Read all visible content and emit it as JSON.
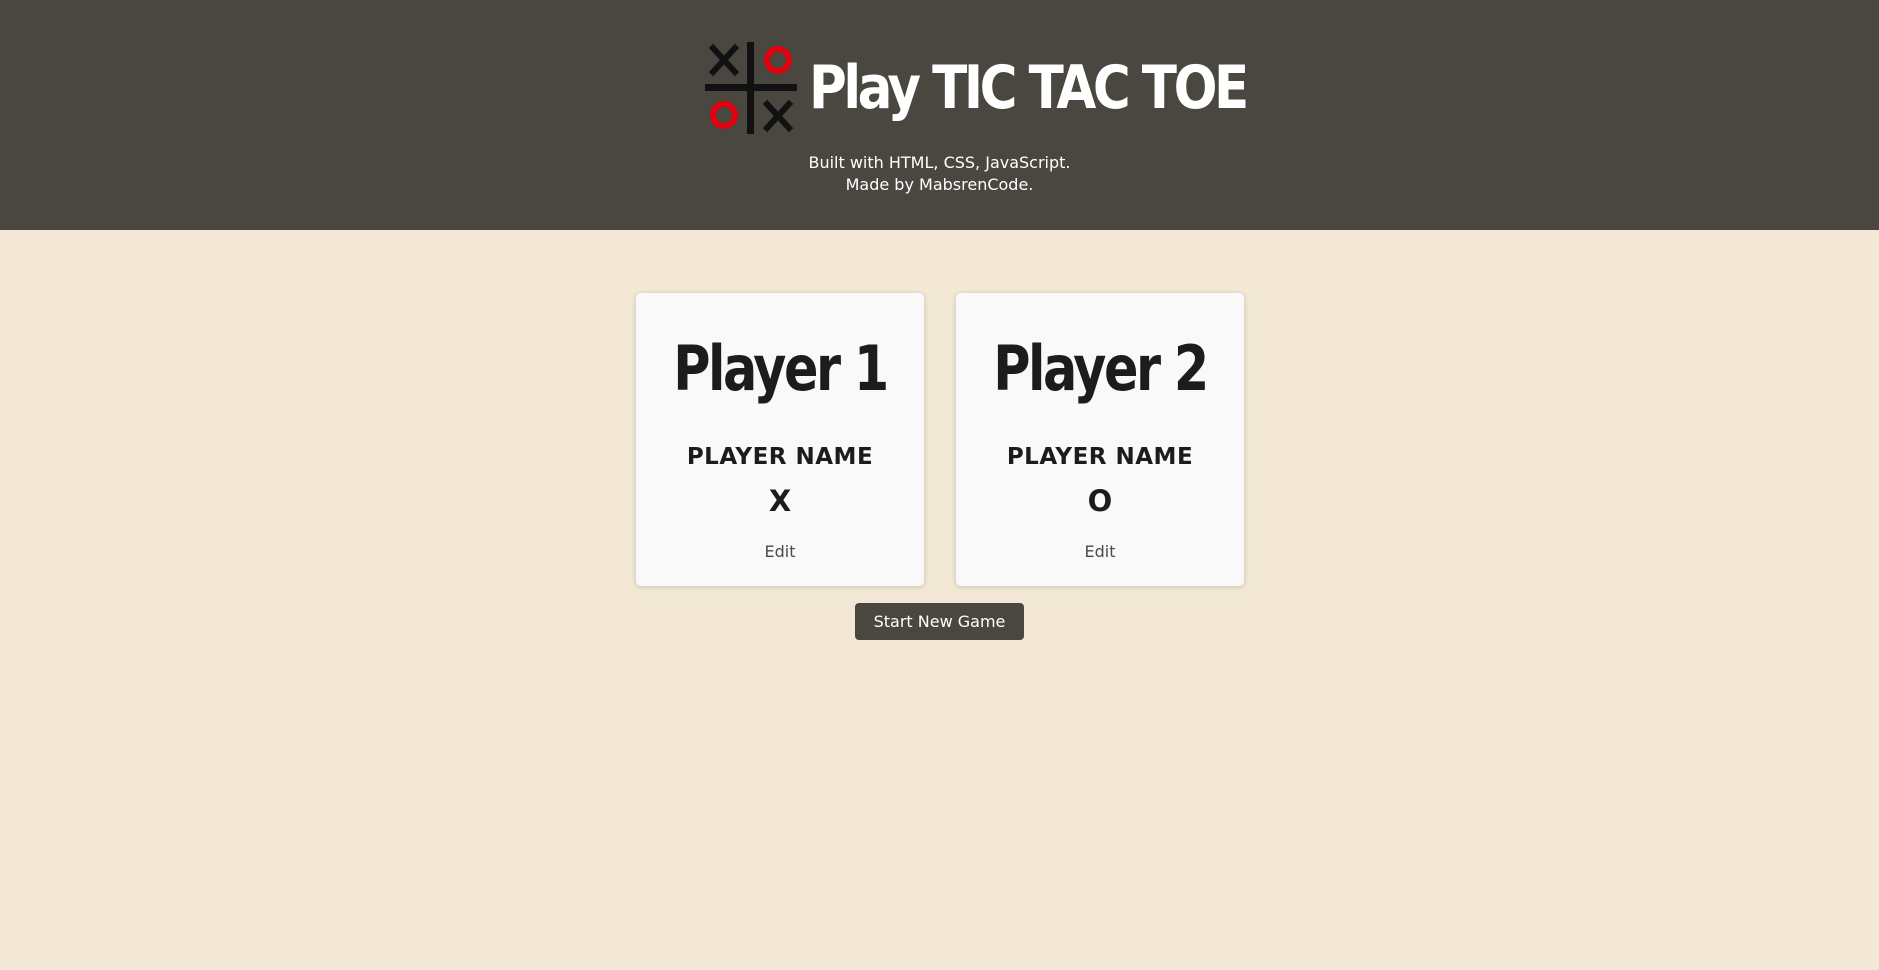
{
  "header": {
    "title": "Play TIC TAC TOE",
    "logo_icon": "tic-tac-toe-logo-icon",
    "credits_line1": "Built with HTML, CSS, JavaScript.",
    "credits_line2": "Made by MabsrenCode."
  },
  "players": [
    {
      "title": "Player 1",
      "name": "PLAYER NAME",
      "symbol": "X",
      "edit_label": "Edit"
    },
    {
      "title": "Player 2",
      "name": "PLAYER NAME",
      "symbol": "O",
      "edit_label": "Edit"
    }
  ],
  "actions": {
    "start_label": "Start New Game"
  },
  "colors": {
    "header_bg": "#4a4640",
    "page_bg": "#f3e8d6",
    "card_bg": "#f9f9f9",
    "logo_o": "#e0000e",
    "text_dark": "#1c1c1c"
  }
}
